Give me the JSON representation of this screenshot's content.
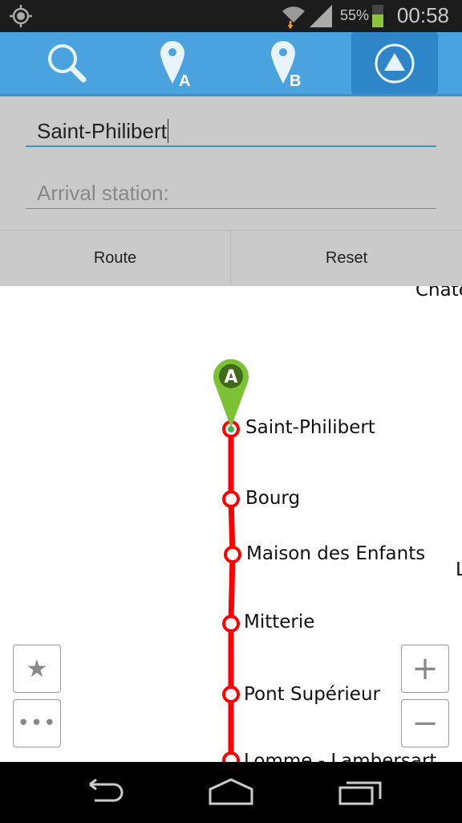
{
  "status_bar": {
    "battery_percent": "55%",
    "time": "00:58",
    "icons": [
      "gps-icon",
      "wifi-icon",
      "signal-icon",
      "battery-charging-icon"
    ]
  },
  "toolbar": {
    "tabs": [
      {
        "icon": "search-icon"
      },
      {
        "icon": "pin-a-icon",
        "letter": "A"
      },
      {
        "icon": "pin-b-icon",
        "letter": "B"
      },
      {
        "icon": "navigate-icon",
        "active": true
      }
    ]
  },
  "form": {
    "departure_value": "Saint-Philibert",
    "arrival_placeholder": "Arrival station:",
    "route_label": "Route",
    "reset_label": "Reset"
  },
  "map": {
    "line_color": "#ff0000",
    "marker_letter": "A",
    "marker_color": "#7cc234",
    "stations": [
      "Saint-Philibert",
      "Bourg",
      "Maison des Enfants",
      "Mitterie",
      "Pont Supérieur",
      "Lomme - Lambersart"
    ],
    "partial_labels": [
      "Chate",
      "L"
    ]
  },
  "map_controls": {
    "favorite": "star-icon",
    "more": "more-icon",
    "zoom_in": "+",
    "zoom_out": "−"
  }
}
